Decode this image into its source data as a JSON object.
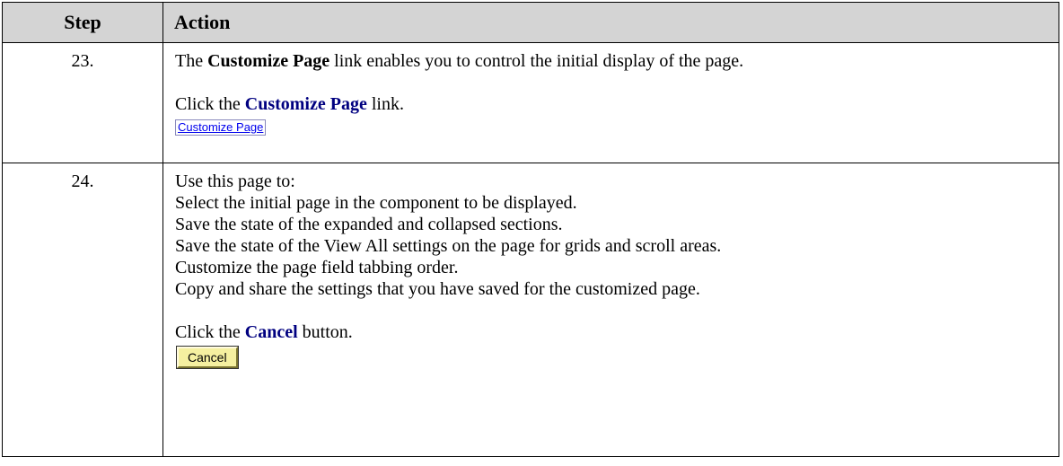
{
  "header": {
    "step": "Step",
    "action": "Action"
  },
  "rows": [
    {
      "step": "23.",
      "intro_pre": "The ",
      "intro_bold": "Customize Page",
      "intro_post": " link enables you to control the initial display of the page.",
      "click_pre": "Click the ",
      "click_bold": "Customize Page",
      "click_post": " link.",
      "shot_label": "Customize Page"
    },
    {
      "step": "24.",
      "lines": [
        "Use this page to:",
        "Select the initial page in the component to be displayed.",
        "Save the state of the expanded and collapsed sections.",
        "Save the state of the View All settings on the page for grids and scroll areas.",
        "Customize the page field tabbing order.",
        "Copy and share the settings that you have saved for the customized page."
      ],
      "click_pre": "Click the ",
      "click_bold": "Cancel",
      "click_post": " button.",
      "shot_label": "Cancel"
    }
  ]
}
